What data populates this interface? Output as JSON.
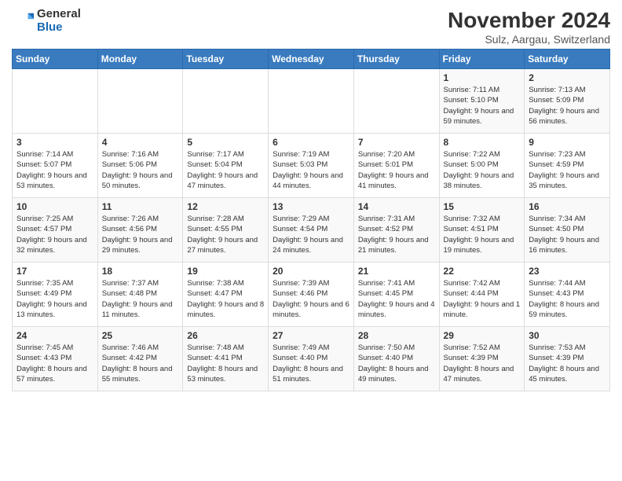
{
  "logo": {
    "general": "General",
    "blue": "Blue"
  },
  "title": "November 2024",
  "subtitle": "Sulz, Aargau, Switzerland",
  "headers": [
    "Sunday",
    "Monday",
    "Tuesday",
    "Wednesday",
    "Thursday",
    "Friday",
    "Saturday"
  ],
  "rows": [
    [
      {
        "day": "",
        "info": ""
      },
      {
        "day": "",
        "info": ""
      },
      {
        "day": "",
        "info": ""
      },
      {
        "day": "",
        "info": ""
      },
      {
        "day": "",
        "info": ""
      },
      {
        "day": "1",
        "info": "Sunrise: 7:11 AM\nSunset: 5:10 PM\nDaylight: 9 hours and 59 minutes."
      },
      {
        "day": "2",
        "info": "Sunrise: 7:13 AM\nSunset: 5:09 PM\nDaylight: 9 hours and 56 minutes."
      }
    ],
    [
      {
        "day": "3",
        "info": "Sunrise: 7:14 AM\nSunset: 5:07 PM\nDaylight: 9 hours and 53 minutes."
      },
      {
        "day": "4",
        "info": "Sunrise: 7:16 AM\nSunset: 5:06 PM\nDaylight: 9 hours and 50 minutes."
      },
      {
        "day": "5",
        "info": "Sunrise: 7:17 AM\nSunset: 5:04 PM\nDaylight: 9 hours and 47 minutes."
      },
      {
        "day": "6",
        "info": "Sunrise: 7:19 AM\nSunset: 5:03 PM\nDaylight: 9 hours and 44 minutes."
      },
      {
        "day": "7",
        "info": "Sunrise: 7:20 AM\nSunset: 5:01 PM\nDaylight: 9 hours and 41 minutes."
      },
      {
        "day": "8",
        "info": "Sunrise: 7:22 AM\nSunset: 5:00 PM\nDaylight: 9 hours and 38 minutes."
      },
      {
        "day": "9",
        "info": "Sunrise: 7:23 AM\nSunset: 4:59 PM\nDaylight: 9 hours and 35 minutes."
      }
    ],
    [
      {
        "day": "10",
        "info": "Sunrise: 7:25 AM\nSunset: 4:57 PM\nDaylight: 9 hours and 32 minutes."
      },
      {
        "day": "11",
        "info": "Sunrise: 7:26 AM\nSunset: 4:56 PM\nDaylight: 9 hours and 29 minutes."
      },
      {
        "day": "12",
        "info": "Sunrise: 7:28 AM\nSunset: 4:55 PM\nDaylight: 9 hours and 27 minutes."
      },
      {
        "day": "13",
        "info": "Sunrise: 7:29 AM\nSunset: 4:54 PM\nDaylight: 9 hours and 24 minutes."
      },
      {
        "day": "14",
        "info": "Sunrise: 7:31 AM\nSunset: 4:52 PM\nDaylight: 9 hours and 21 minutes."
      },
      {
        "day": "15",
        "info": "Sunrise: 7:32 AM\nSunset: 4:51 PM\nDaylight: 9 hours and 19 minutes."
      },
      {
        "day": "16",
        "info": "Sunrise: 7:34 AM\nSunset: 4:50 PM\nDaylight: 9 hours and 16 minutes."
      }
    ],
    [
      {
        "day": "17",
        "info": "Sunrise: 7:35 AM\nSunset: 4:49 PM\nDaylight: 9 hours and 13 minutes."
      },
      {
        "day": "18",
        "info": "Sunrise: 7:37 AM\nSunset: 4:48 PM\nDaylight: 9 hours and 11 minutes."
      },
      {
        "day": "19",
        "info": "Sunrise: 7:38 AM\nSunset: 4:47 PM\nDaylight: 9 hours and 8 minutes."
      },
      {
        "day": "20",
        "info": "Sunrise: 7:39 AM\nSunset: 4:46 PM\nDaylight: 9 hours and 6 minutes."
      },
      {
        "day": "21",
        "info": "Sunrise: 7:41 AM\nSunset: 4:45 PM\nDaylight: 9 hours and 4 minutes."
      },
      {
        "day": "22",
        "info": "Sunrise: 7:42 AM\nSunset: 4:44 PM\nDaylight: 9 hours and 1 minute."
      },
      {
        "day": "23",
        "info": "Sunrise: 7:44 AM\nSunset: 4:43 PM\nDaylight: 8 hours and 59 minutes."
      }
    ],
    [
      {
        "day": "24",
        "info": "Sunrise: 7:45 AM\nSunset: 4:43 PM\nDaylight: 8 hours and 57 minutes."
      },
      {
        "day": "25",
        "info": "Sunrise: 7:46 AM\nSunset: 4:42 PM\nDaylight: 8 hours and 55 minutes."
      },
      {
        "day": "26",
        "info": "Sunrise: 7:48 AM\nSunset: 4:41 PM\nDaylight: 8 hours and 53 minutes."
      },
      {
        "day": "27",
        "info": "Sunrise: 7:49 AM\nSunset: 4:40 PM\nDaylight: 8 hours and 51 minutes."
      },
      {
        "day": "28",
        "info": "Sunrise: 7:50 AM\nSunset: 4:40 PM\nDaylight: 8 hours and 49 minutes."
      },
      {
        "day": "29",
        "info": "Sunrise: 7:52 AM\nSunset: 4:39 PM\nDaylight: 8 hours and 47 minutes."
      },
      {
        "day": "30",
        "info": "Sunrise: 7:53 AM\nSunset: 4:39 PM\nDaylight: 8 hours and 45 minutes."
      }
    ]
  ]
}
